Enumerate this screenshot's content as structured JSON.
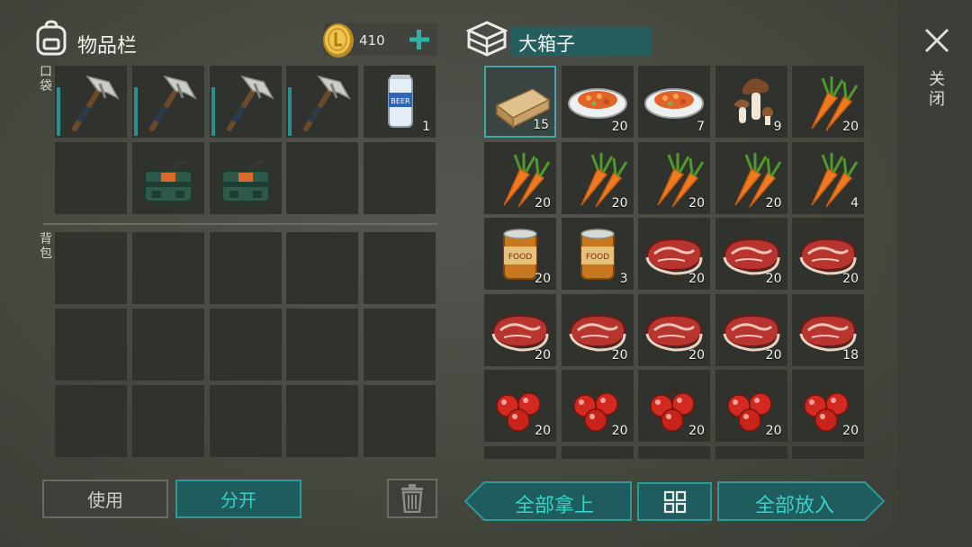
{
  "inventory": {
    "title": "物品栏",
    "coins": "410",
    "pockets_label": "口袋",
    "backpack_label": "背包",
    "pockets": [
      {
        "item": "pickaxe-icon",
        "count": "",
        "durability": true
      },
      {
        "item": "pickaxe-icon",
        "count": "",
        "durability": true
      },
      {
        "item": "pickaxe-icon",
        "count": "",
        "durability": true
      },
      {
        "item": "pickaxe-icon",
        "count": "",
        "durability": true
      },
      {
        "item": "beer-can-icon",
        "count": "1",
        "durability": false
      },
      {
        "item": "",
        "count": "",
        "durability": false
      },
      {
        "item": "c4-explosive-icon",
        "count": "",
        "durability": false
      },
      {
        "item": "c4-explosive-icon",
        "count": "",
        "durability": false
      },
      {
        "item": "",
        "count": "",
        "durability": false
      },
      {
        "item": "",
        "count": "",
        "durability": false
      }
    ]
  },
  "container": {
    "title": "大箱子",
    "close_label": "关闭",
    "slots": [
      {
        "item": "wood-plank-icon",
        "count": "15"
      },
      {
        "item": "cooked-dish-icon",
        "count": "20"
      },
      {
        "item": "cooked-dish-icon",
        "count": "7"
      },
      {
        "item": "mushroom-icon",
        "count": "9"
      },
      {
        "item": "carrot-icon",
        "count": "20"
      },
      {
        "item": "carrot-icon",
        "count": "20"
      },
      {
        "item": "carrot-icon",
        "count": "20"
      },
      {
        "item": "carrot-icon",
        "count": "20"
      },
      {
        "item": "carrot-icon",
        "count": "20"
      },
      {
        "item": "carrot-icon",
        "count": "4"
      },
      {
        "item": "canned-food-icon",
        "count": "20"
      },
      {
        "item": "canned-food-icon",
        "count": "3"
      },
      {
        "item": "raw-meat-icon",
        "count": "20"
      },
      {
        "item": "raw-meat-icon",
        "count": "20"
      },
      {
        "item": "raw-meat-icon",
        "count": "20"
      },
      {
        "item": "raw-meat-icon",
        "count": "20"
      },
      {
        "item": "raw-meat-icon",
        "count": "20"
      },
      {
        "item": "raw-meat-icon",
        "count": "20"
      },
      {
        "item": "raw-meat-icon",
        "count": "20"
      },
      {
        "item": "raw-meat-icon",
        "count": "18"
      },
      {
        "item": "berries-icon",
        "count": "20"
      },
      {
        "item": "berries-icon",
        "count": "20"
      },
      {
        "item": "berries-icon",
        "count": "20"
      },
      {
        "item": "berries-icon",
        "count": "20"
      },
      {
        "item": "berries-icon",
        "count": "20"
      }
    ]
  },
  "buttons": {
    "use": "使用",
    "split": "分开",
    "take_all": "全部拿上",
    "put_all": "全部放入"
  },
  "colors": {
    "accent_teal": "#1f6466",
    "teal_border": "#2d9a98",
    "selected_border": "#3fa9a6"
  }
}
